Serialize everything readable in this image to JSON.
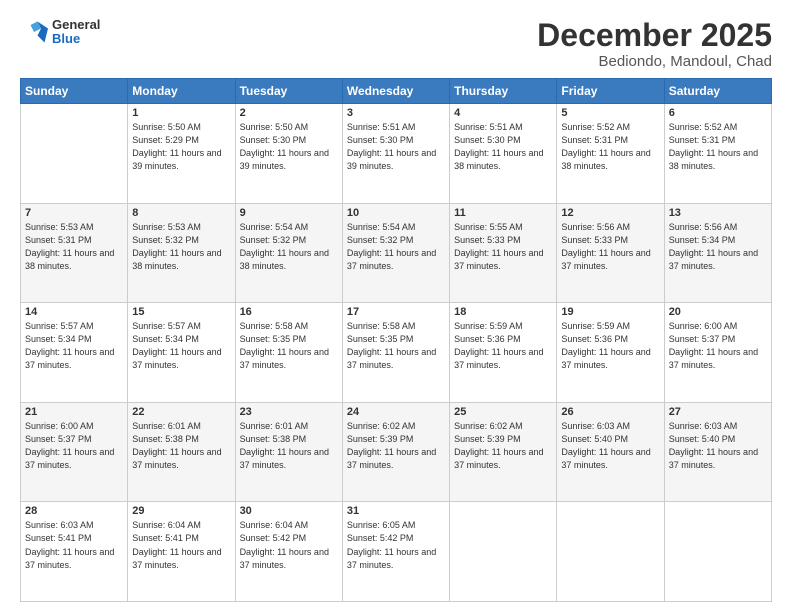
{
  "header": {
    "logo": {
      "general": "General",
      "blue": "Blue"
    },
    "title": "December 2025",
    "subtitle": "Bediondo, Mandoul, Chad"
  },
  "days_of_week": [
    "Sunday",
    "Monday",
    "Tuesday",
    "Wednesday",
    "Thursday",
    "Friday",
    "Saturday"
  ],
  "weeks": [
    [
      {
        "day": "",
        "info": ""
      },
      {
        "day": "1",
        "info": "Sunrise: 5:50 AM\nSunset: 5:29 PM\nDaylight: 11 hours\nand 39 minutes."
      },
      {
        "day": "2",
        "info": "Sunrise: 5:50 AM\nSunset: 5:30 PM\nDaylight: 11 hours\nand 39 minutes."
      },
      {
        "day": "3",
        "info": "Sunrise: 5:51 AM\nSunset: 5:30 PM\nDaylight: 11 hours\nand 39 minutes."
      },
      {
        "day": "4",
        "info": "Sunrise: 5:51 AM\nSunset: 5:30 PM\nDaylight: 11 hours\nand 38 minutes."
      },
      {
        "day": "5",
        "info": "Sunrise: 5:52 AM\nSunset: 5:31 PM\nDaylight: 11 hours\nand 38 minutes."
      },
      {
        "day": "6",
        "info": "Sunrise: 5:52 AM\nSunset: 5:31 PM\nDaylight: 11 hours\nand 38 minutes."
      }
    ],
    [
      {
        "day": "7",
        "info": "Sunrise: 5:53 AM\nSunset: 5:31 PM\nDaylight: 11 hours\nand 38 minutes."
      },
      {
        "day": "8",
        "info": "Sunrise: 5:53 AM\nSunset: 5:32 PM\nDaylight: 11 hours\nand 38 minutes."
      },
      {
        "day": "9",
        "info": "Sunrise: 5:54 AM\nSunset: 5:32 PM\nDaylight: 11 hours\nand 38 minutes."
      },
      {
        "day": "10",
        "info": "Sunrise: 5:54 AM\nSunset: 5:32 PM\nDaylight: 11 hours\nand 37 minutes."
      },
      {
        "day": "11",
        "info": "Sunrise: 5:55 AM\nSunset: 5:33 PM\nDaylight: 11 hours\nand 37 minutes."
      },
      {
        "day": "12",
        "info": "Sunrise: 5:56 AM\nSunset: 5:33 PM\nDaylight: 11 hours\nand 37 minutes."
      },
      {
        "day": "13",
        "info": "Sunrise: 5:56 AM\nSunset: 5:34 PM\nDaylight: 11 hours\nand 37 minutes."
      }
    ],
    [
      {
        "day": "14",
        "info": "Sunrise: 5:57 AM\nSunset: 5:34 PM\nDaylight: 11 hours\nand 37 minutes."
      },
      {
        "day": "15",
        "info": "Sunrise: 5:57 AM\nSunset: 5:34 PM\nDaylight: 11 hours\nand 37 minutes."
      },
      {
        "day": "16",
        "info": "Sunrise: 5:58 AM\nSunset: 5:35 PM\nDaylight: 11 hours\nand 37 minutes."
      },
      {
        "day": "17",
        "info": "Sunrise: 5:58 AM\nSunset: 5:35 PM\nDaylight: 11 hours\nand 37 minutes."
      },
      {
        "day": "18",
        "info": "Sunrise: 5:59 AM\nSunset: 5:36 PM\nDaylight: 11 hours\nand 37 minutes."
      },
      {
        "day": "19",
        "info": "Sunrise: 5:59 AM\nSunset: 5:36 PM\nDaylight: 11 hours\nand 37 minutes."
      },
      {
        "day": "20",
        "info": "Sunrise: 6:00 AM\nSunset: 5:37 PM\nDaylight: 11 hours\nand 37 minutes."
      }
    ],
    [
      {
        "day": "21",
        "info": "Sunrise: 6:00 AM\nSunset: 5:37 PM\nDaylight: 11 hours\nand 37 minutes."
      },
      {
        "day": "22",
        "info": "Sunrise: 6:01 AM\nSunset: 5:38 PM\nDaylight: 11 hours\nand 37 minutes."
      },
      {
        "day": "23",
        "info": "Sunrise: 6:01 AM\nSunset: 5:38 PM\nDaylight: 11 hours\nand 37 minutes."
      },
      {
        "day": "24",
        "info": "Sunrise: 6:02 AM\nSunset: 5:39 PM\nDaylight: 11 hours\nand 37 minutes."
      },
      {
        "day": "25",
        "info": "Sunrise: 6:02 AM\nSunset: 5:39 PM\nDaylight: 11 hours\nand 37 minutes."
      },
      {
        "day": "26",
        "info": "Sunrise: 6:03 AM\nSunset: 5:40 PM\nDaylight: 11 hours\nand 37 minutes."
      },
      {
        "day": "27",
        "info": "Sunrise: 6:03 AM\nSunset: 5:40 PM\nDaylight: 11 hours\nand 37 minutes."
      }
    ],
    [
      {
        "day": "28",
        "info": "Sunrise: 6:03 AM\nSunset: 5:41 PM\nDaylight: 11 hours\nand 37 minutes."
      },
      {
        "day": "29",
        "info": "Sunrise: 6:04 AM\nSunset: 5:41 PM\nDaylight: 11 hours\nand 37 minutes."
      },
      {
        "day": "30",
        "info": "Sunrise: 6:04 AM\nSunset: 5:42 PM\nDaylight: 11 hours\nand 37 minutes."
      },
      {
        "day": "31",
        "info": "Sunrise: 6:05 AM\nSunset: 5:42 PM\nDaylight: 11 hours\nand 37 minutes."
      },
      {
        "day": "",
        "info": ""
      },
      {
        "day": "",
        "info": ""
      },
      {
        "day": "",
        "info": ""
      }
    ]
  ]
}
